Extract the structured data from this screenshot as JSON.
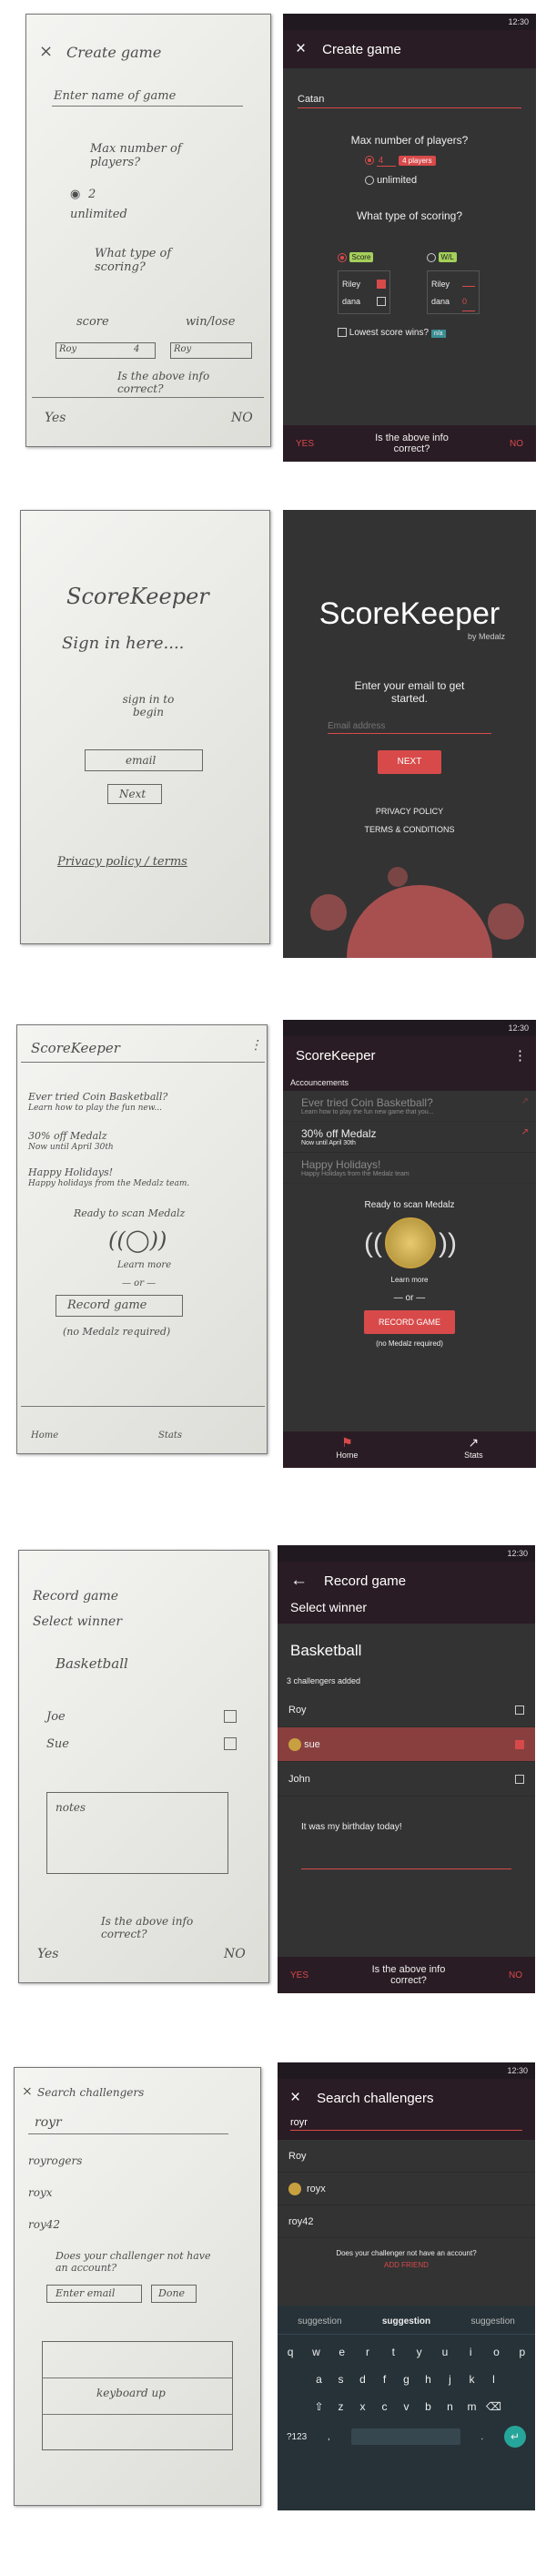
{
  "screen1": {
    "sketch": {
      "title": "Create game",
      "name_field": "Enter name of game",
      "max_players": "Max number of players?",
      "num": "2",
      "unlimited": "unlimited",
      "scoring_q": "What type of scoring?",
      "score": "score",
      "winlose": "win/lose",
      "p1": "Roy",
      "p1v": "4",
      "p2": "Roy",
      "correct": "Is the above info correct?",
      "yes": "Yes",
      "no": "NO"
    },
    "app": {
      "status": "12:30",
      "title": "Create game",
      "name_value": "Catan",
      "max_label": "Max number of players?",
      "max_value": "4",
      "players_tag": "4 players",
      "unlimited": "unlimited",
      "scoring_label": "What type of scoring?",
      "score_tag": "Score",
      "wl_tag": "W/L",
      "p1": "Riley",
      "p2": "dana",
      "p1b": "Riley",
      "p2b": "dana",
      "p2bv": "0",
      "lowest": "Lowest score wins?",
      "lowest_tag": "n/a",
      "yes": "YES",
      "question": "Is the above info correct?",
      "no": "NO"
    }
  },
  "screen2": {
    "sketch": {
      "title": "ScoreKeeper",
      "signin": "Sign in here....",
      "sign_to": "sign in to begin",
      "email": "email",
      "next": "Next",
      "privacy": "Privacy policy / terms"
    },
    "app": {
      "title": "ScoreKeeper",
      "by": "by Medalz",
      "prompt": "Enter your email to get started.",
      "placeholder": "Email address",
      "next": "NEXT",
      "privacy": "PRIVACY POLICY",
      "terms": "TERMS & CONDITIONS"
    }
  },
  "screen3": {
    "sketch": {
      "title": "ScoreKeeper",
      "a1": "Ever tried Coin Basketball?",
      "a1s": "Learn how to play the fun new...",
      "a2": "30% off Medalz",
      "a2s": "Now until April 30th",
      "a3": "Happy Holidays!",
      "a3s": "Happy holidays from the Medalz team.",
      "ready": "Ready to scan Medalz",
      "learn": "Learn more",
      "or": "— or —",
      "record": "Record game",
      "no_medalz": "(no Medalz required)",
      "home": "Home",
      "stats": "Stats"
    },
    "app": {
      "status": "12:30",
      "title": "ScoreKeeper",
      "section": "Accouncements",
      "items": [
        {
          "t": "Ever tried Coin Basketball?",
          "s": "Learn how to play the fun new game that you..."
        },
        {
          "t": "30% off Medalz",
          "s": "Now until April 30th"
        },
        {
          "t": "Happy Holidays!",
          "s": "Happy Holidays from the Medalz team"
        }
      ],
      "ready": "Ready to scan Medalz",
      "learn": "Learn more",
      "or": "or",
      "record": "RECORD GAME",
      "no_medalz": "(no Medalz required)",
      "home": "Home",
      "stats": "Stats"
    }
  },
  "screen4": {
    "sketch": {
      "title": "Record game",
      "select": "Select winner",
      "game": "Basketball",
      "p1": "Joe",
      "p2": "Sue",
      "notes": "notes",
      "correct": "Is the above info correct?",
      "yes": "Yes",
      "no": "NO"
    },
    "app": {
      "status": "12:30",
      "title": "Record game",
      "select": "Select winner",
      "game": "Basketball",
      "count": "3 challengers added",
      "players": [
        "Roy",
        "sue",
        "John"
      ],
      "note": "It was my birthday today!",
      "yes": "YES",
      "question": "Is the above info correct?",
      "no": "NO"
    }
  },
  "screen5": {
    "sketch": {
      "title": "Search challengers",
      "query": "royr",
      "r1": "royrogers",
      "r2": "royx",
      "r3": "roy42",
      "q": "Does your challenger not have an account?",
      "enter_email": "Enter email",
      "done": "Done",
      "keyboard": "keyboard up"
    },
    "app": {
      "status": "12:30",
      "title": "Search challengers",
      "query": "royr",
      "results": [
        "Roy",
        "royx",
        "roy42"
      ],
      "q": "Does your challenger not have an account?",
      "add": "ADD FRIEND",
      "suggestions": [
        "suggestion",
        "suggestion",
        "suggestion"
      ],
      "row1": [
        "q",
        "w",
        "e",
        "r",
        "t",
        "y",
        "u",
        "i",
        "o",
        "p"
      ],
      "row2": [
        "a",
        "s",
        "d",
        "f",
        "g",
        "h",
        "j",
        "k",
        "l"
      ],
      "row3": [
        "z",
        "x",
        "c",
        "v",
        "b",
        "n",
        "m"
      ],
      "k123": "?123"
    }
  }
}
